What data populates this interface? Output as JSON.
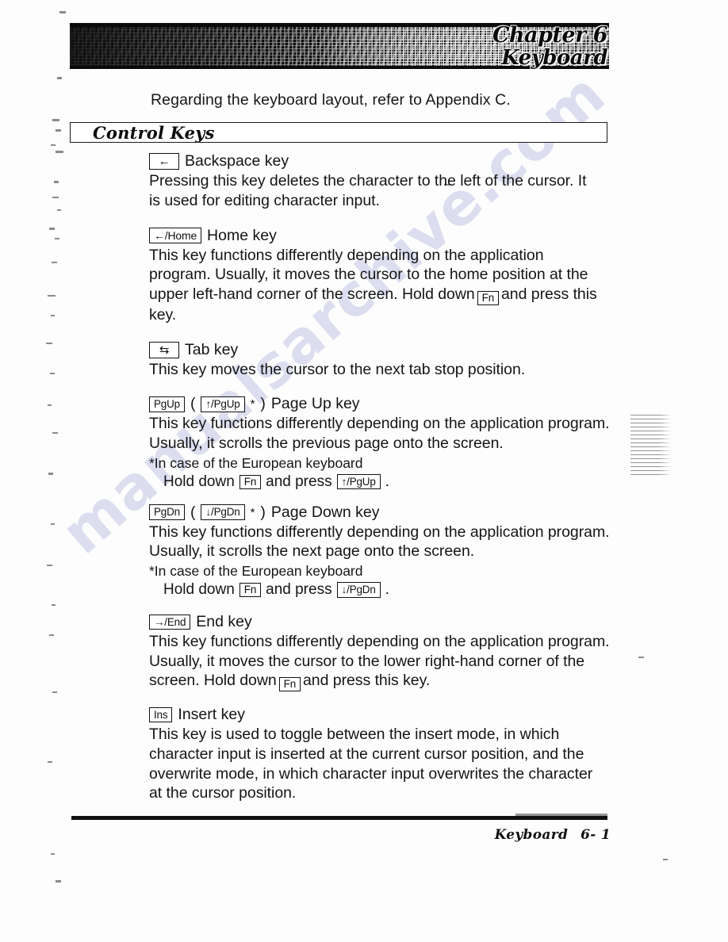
{
  "header": {
    "chapter_number": "Chapter 6",
    "chapter_name": "Keyboard"
  },
  "watermark": {
    "text": "manualsarchive.com"
  },
  "intro": {
    "text": "Regarding the keyboard layout, refer to Appendix C."
  },
  "section": {
    "title": "Control Keys"
  },
  "keys": {
    "backspace": {
      "cap": "←",
      "label": "Backspace key",
      "body_line_1": "Pressing this key deletes the character to the left of the cursor.  It",
      "body_line_2": "is used for editing character input."
    },
    "home": {
      "cap": "←/Home",
      "label": "Home key",
      "body_line_1": "This key functions differently depending on the application",
      "body_line_2": "program. Usually, it moves the cursor to the home position at the",
      "body_line_3_a": "upper left-hand corner of the screen. Hold down",
      "body_fn_cap": "Fn",
      "body_line_3_b": "and press this",
      "body_line_4": "key."
    },
    "tab": {
      "cap": "⇆",
      "label": "Tab key",
      "body_line_1": "This key moves the cursor to the next tab stop position."
    },
    "pageup": {
      "cap": "PgUp",
      "alt_cap": "↑/PgUp",
      "asterisk": "*",
      "paren_open": "(",
      "paren_close": ")",
      "label": "Page Up key",
      "body_line_1": "This key functions differently depending on the application program.",
      "body_line_2": "Usually, it scrolls the previous page onto the screen.",
      "note": "*In case of the European keyboard",
      "note_hold": "Hold down",
      "note_fn_cap": "Fn",
      "note_press": "and press",
      "note_cap": "↑/PgUp",
      "note_period": "."
    },
    "pagedown": {
      "cap": "PgDn",
      "alt_cap": "↓/PgDn",
      "asterisk": "*",
      "paren_open": "(",
      "paren_close": ")",
      "label": "Page Down key",
      "body_line_1": "This key functions differently depending on the application program.",
      "body_line_2": "Usually, it scrolls the next page onto the screen.",
      "note": "*In case of the European keyboard",
      "note_hold": "Hold down",
      "note_fn_cap": "Fn",
      "note_press": "and press",
      "note_cap": "↓/PgDn",
      "note_period": "."
    },
    "end": {
      "cap": "→/End",
      "label": "End key",
      "body_line_1": "This key functions differently depending on the application program.",
      "body_line_2": "Usually, it moves the cursor to the lower right-hand corner of the",
      "body_line_3_a": "screen. Hold down",
      "body_fn_cap": "Fn",
      "body_line_3_b": "and press this key."
    },
    "insert": {
      "cap": "Ins",
      "label": "Insert key",
      "body_line_1": "This key is used to toggle between the insert mode, in which",
      "body_line_2": "character input is inserted at the current cursor position, and the",
      "body_line_3": "overwrite mode, in which character input overwrites the character",
      "body_line_4": "at the cursor position."
    }
  },
  "footer": {
    "section_name": "Keyboard",
    "page_number": "6- 1"
  }
}
